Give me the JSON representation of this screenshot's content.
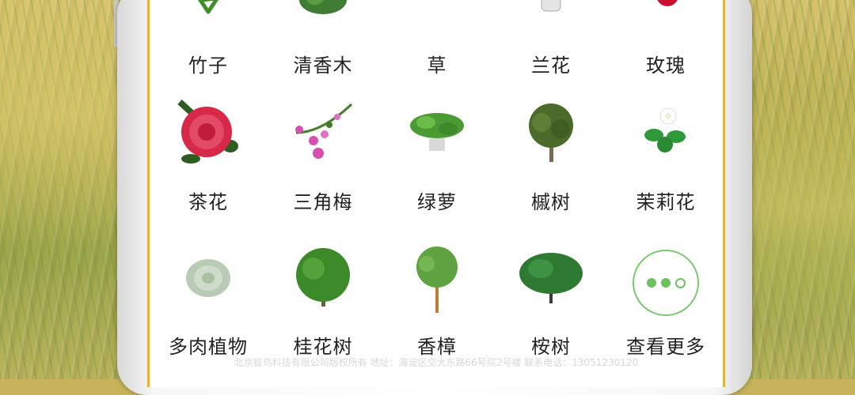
{
  "plants": [
    {
      "label": "竹子",
      "icon": "bamboo-icon"
    },
    {
      "label": "清香木",
      "icon": "fragrant-wood-icon"
    },
    {
      "label": "草",
      "icon": "grass-icon"
    },
    {
      "label": "兰花",
      "icon": "orchid-icon"
    },
    {
      "label": "玫瑰",
      "icon": "rose-icon"
    },
    {
      "label": "茶花",
      "icon": "camellia-icon"
    },
    {
      "label": "三角梅",
      "icon": "bougainvillea-icon"
    },
    {
      "label": "绿萝",
      "icon": "pothos-icon"
    },
    {
      "label": "槭树",
      "icon": "maple-tree-icon"
    },
    {
      "label": "茉莉花",
      "icon": "jasmine-icon"
    },
    {
      "label": "多肉植物",
      "icon": "succulent-icon"
    },
    {
      "label": "桂花树",
      "icon": "osmanthus-tree-icon"
    },
    {
      "label": "香樟",
      "icon": "camphor-tree-icon"
    },
    {
      "label": "桉树",
      "icon": "eucalyptus-tree-icon"
    }
  ],
  "more": {
    "label": "查看更多",
    "icon": "more-dots-icon"
  },
  "footer": "北京智鸟科技有限公司版权所有 地址：海淀区交大东路66号院2号楼 联系电话：13051230120",
  "colors": {
    "border": "#f3b11c",
    "accent": "#6dbf5f",
    "text": "#222222"
  }
}
